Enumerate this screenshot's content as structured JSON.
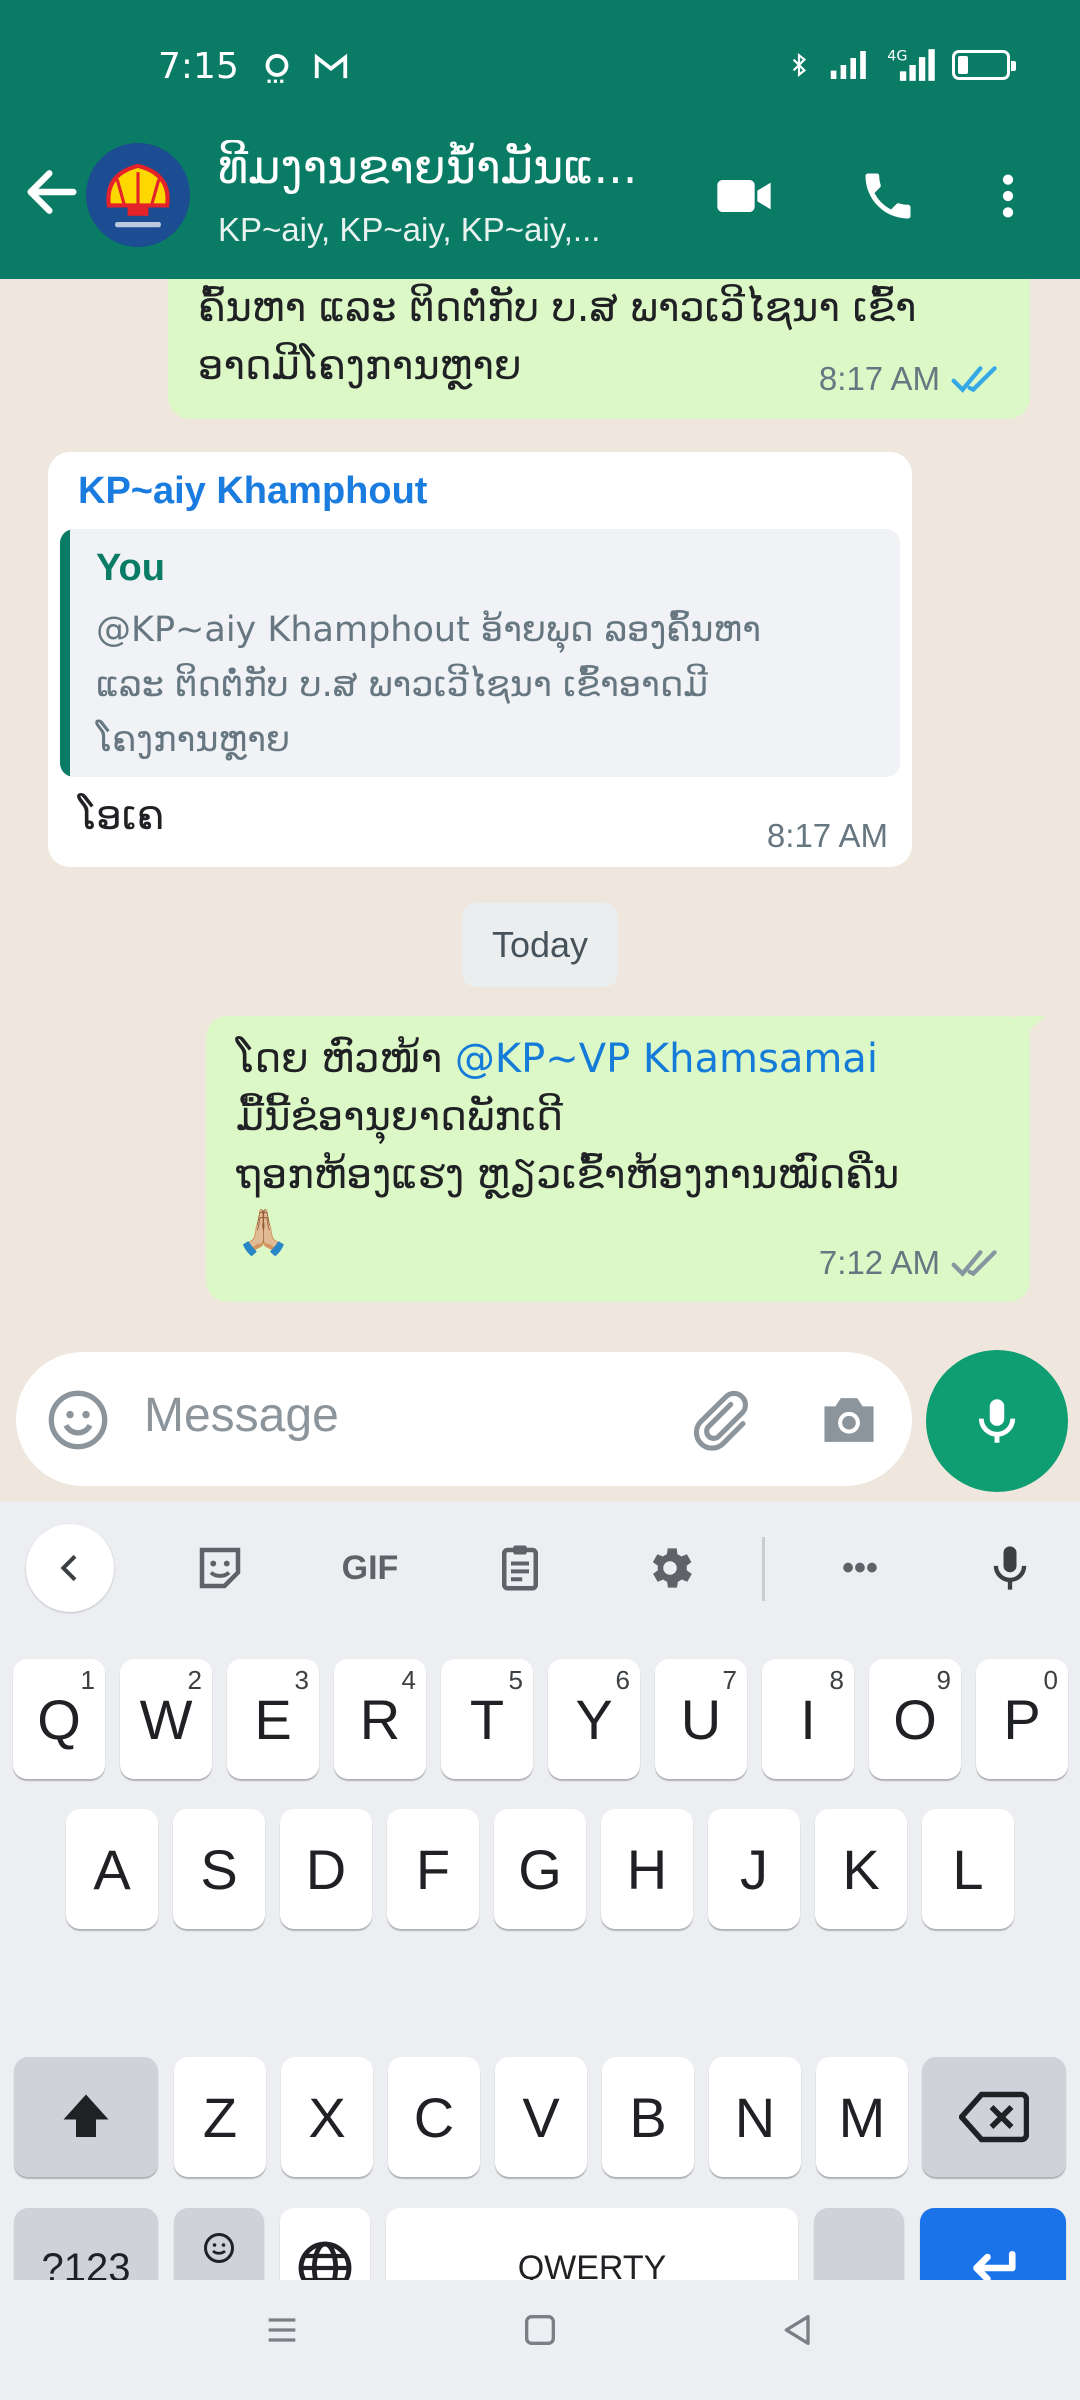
{
  "status_bar": {
    "time": "7:15",
    "battery": "5",
    "network": "4G"
  },
  "header": {
    "title": "ທີມງານຂາຍນ້ຳມັນແ...",
    "subtitle": "KP~aiy, KP~aiy, KP~aiy,...",
    "icons": [
      "back-arrow-icon",
      "video-call-icon",
      "phone-icon",
      "more-icon"
    ]
  },
  "messages": [
    {
      "direction": "out",
      "lines": [
        "ຄົ້ນຫາ ແລະ ຕິດຕໍ່ກັບ ບ.ສ ພາວເວີໄຊນາ ເຂົ້າ",
        "ອາດມີໂຄງການຫຼາຍ"
      ],
      "time": "8:17 AM",
      "status": "read"
    },
    {
      "direction": "in",
      "sender": "KP~aiy Khamphout",
      "quote": {
        "name": "You",
        "lines": [
          "@KP~aiy Khamphout ອ້າຍພຸດ ລອງຄົ້ນຫາ",
          "ແລະ ຕິດຕໍ່ກັບ ບ.ສ ພາວເວີໄຊນາ ເຂົ້າອາດມີ",
          "ໂຄງການຫຼາຍ"
        ]
      },
      "text": "ໂອເຄ",
      "time": "8:17 AM"
    },
    {
      "direction": "out",
      "line1_prefix": "ໂດຍ ຫົວໜ້າ ",
      "mention": "@KP~VP Khamsamai",
      "line2": "ມື້ນີ້ຂໍອານຸຍາດພັກເດີ",
      "line3": "ຖອກຫ້ອງແຮງ ຫຼຽວເຂົ້າຫ້ອງການໝົດຄືນ",
      "emoji": "🙏🏼",
      "time": "7:12 AM",
      "status": "delivered"
    }
  ],
  "date_divider": "Today",
  "composer": {
    "placeholder": "Message"
  },
  "keyboard": {
    "toolbar": {
      "gif_label": "GIF",
      "more_label": "•••"
    },
    "row1": [
      {
        "k": "Q",
        "h": "1"
      },
      {
        "k": "W",
        "h": "2"
      },
      {
        "k": "E",
        "h": "3"
      },
      {
        "k": "R",
        "h": "4"
      },
      {
        "k": "T",
        "h": "5"
      },
      {
        "k": "Y",
        "h": "6"
      },
      {
        "k": "U",
        "h": "7"
      },
      {
        "k": "I",
        "h": "8"
      },
      {
        "k": "O",
        "h": "9"
      },
      {
        "k": "P",
        "h": "0"
      }
    ],
    "row2": [
      "A",
      "S",
      "D",
      "F",
      "G",
      "H",
      "J",
      "K",
      "L"
    ],
    "row3": [
      "Z",
      "X",
      "C",
      "V",
      "B",
      "N",
      "M"
    ],
    "symbols_label": "?123",
    "comma_label": ",",
    "space_label": "QWERTY",
    "period_label": "."
  }
}
